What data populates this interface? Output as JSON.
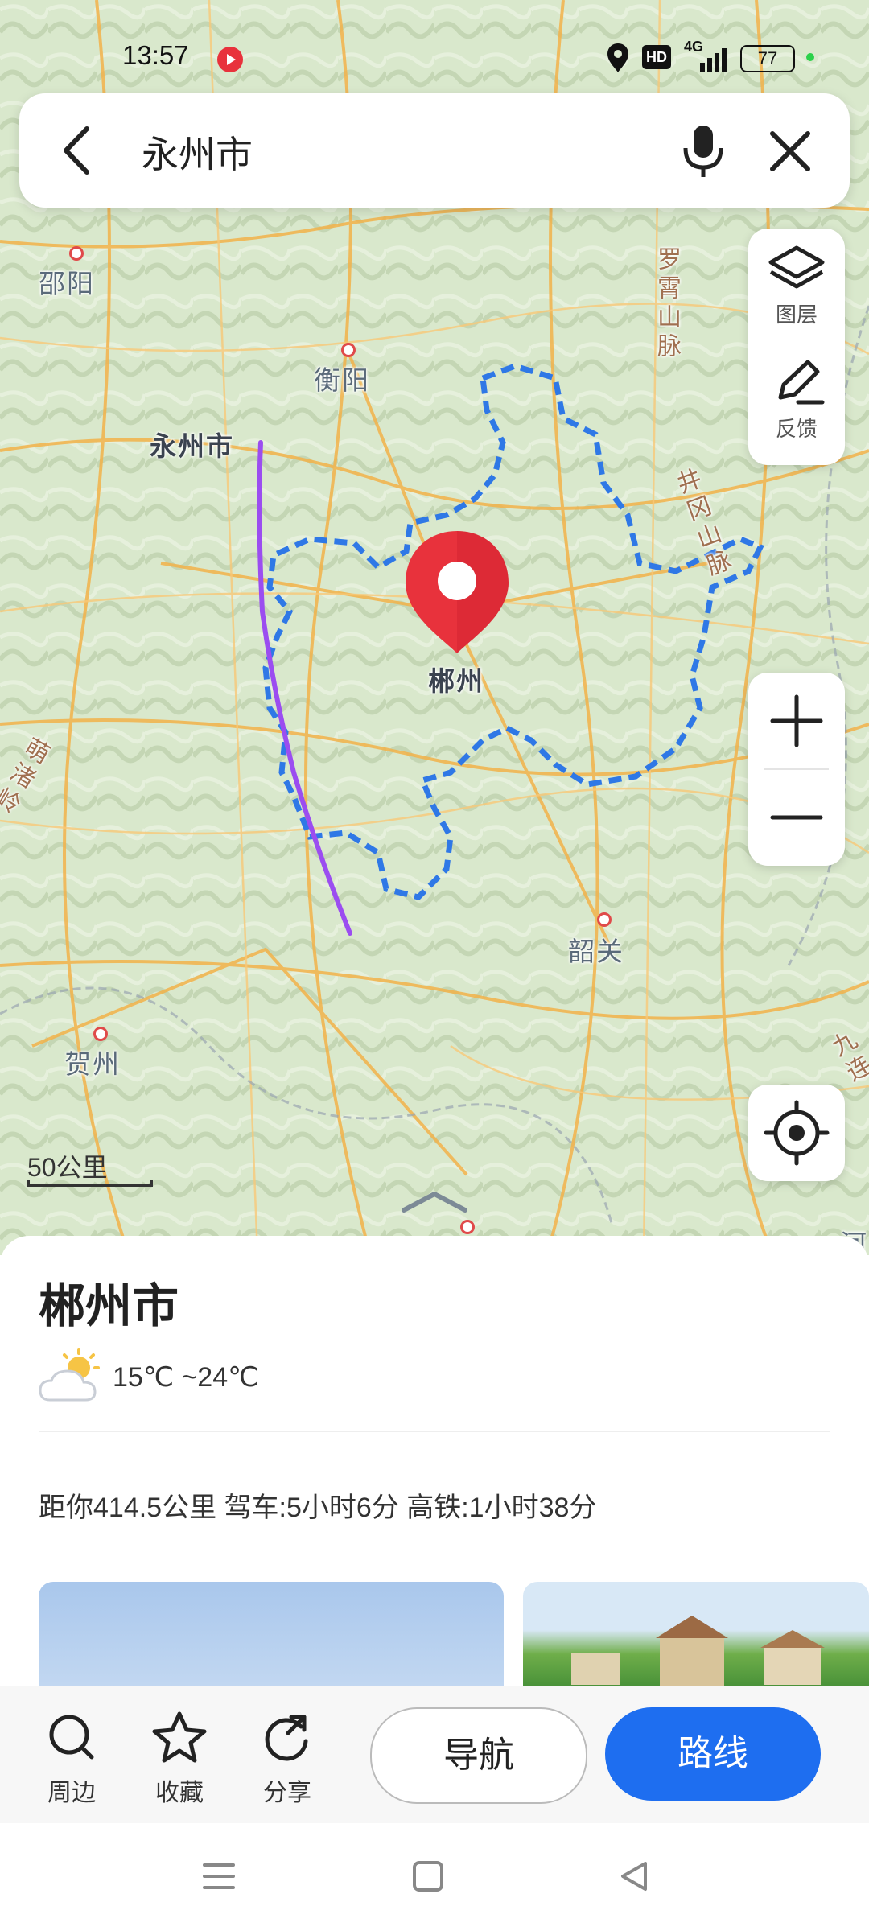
{
  "status_bar": {
    "time": "13:57",
    "network": "4G",
    "hd": "HD",
    "battery": "77"
  },
  "search": {
    "query": "永州市"
  },
  "map": {
    "places": {
      "shaoyang": "邵阳",
      "hengyang": "衡阳",
      "yongzhou": "永州市",
      "chenzhou": "郴州",
      "shaoguan": "韶关",
      "hezhou": "贺州",
      "luoxiao": "罗霄山脉",
      "jinggang": "井冈山脉",
      "mengzhuling": "萌渚岭",
      "jiulian": "九连",
      "he": "河"
    },
    "layers_label": "图层",
    "feedback_label": "反馈",
    "scale_label": "50公里"
  },
  "place_card": {
    "title": "郴州市",
    "weather": "15℃ ~24℃",
    "distance": "距你414.5公里 驾车:5小时6分 高铁:1小时38分"
  },
  "actions": {
    "nearby": "周边",
    "favorite": "收藏",
    "share": "分享",
    "navigate": "导航",
    "route": "路线"
  },
  "colors": {
    "accent": "#1e6ef0",
    "boundary": "#2f78e6",
    "track": "#9b4df0",
    "pin": "#e8323c"
  }
}
